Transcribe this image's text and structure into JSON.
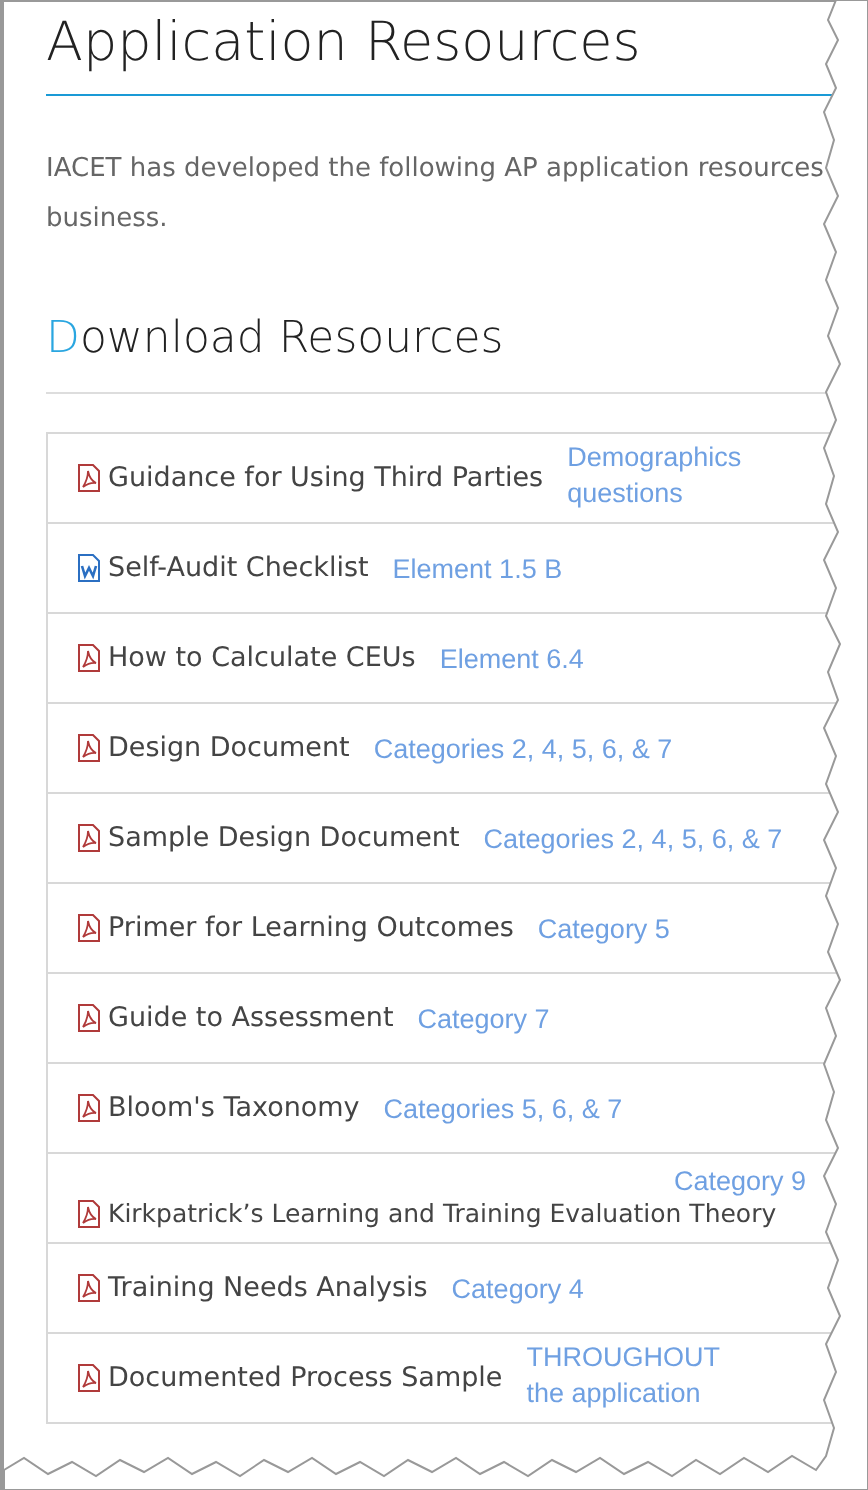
{
  "title": "Application Resources",
  "intro_lines": [
    "IACET has developed the following AP application resources",
    "business."
  ],
  "section_heading": "Download Resources",
  "resources": [
    {
      "kind": "pdf",
      "title": "Guidance for Using Third Parties",
      "note": {
        "kind": "beside",
        "lines": [
          "Demographics",
          "questions"
        ]
      }
    },
    {
      "kind": "word",
      "title": "Self-Audit Checklist",
      "note": {
        "kind": "beside",
        "lines": [
          "Element 1.5 B"
        ]
      }
    },
    {
      "kind": "pdf",
      "title": "How to Calculate CEUs",
      "note": {
        "kind": "beside",
        "lines": [
          "Element 6.4"
        ]
      }
    },
    {
      "kind": "pdf",
      "title": "Design Document",
      "note": {
        "kind": "beside",
        "lines": [
          "Categories 2, 4, 5, 6, & 7"
        ]
      }
    },
    {
      "kind": "pdf",
      "title": "Sample Design Document",
      "note": {
        "kind": "beside",
        "lines": [
          "Categories 2, 4, 5, 6, & 7"
        ]
      }
    },
    {
      "kind": "pdf",
      "title": "Primer for Learning Outcomes",
      "note": {
        "kind": "beside",
        "lines": [
          "Category 5"
        ]
      }
    },
    {
      "kind": "pdf",
      "title": "Guide to Assessment",
      "note": {
        "kind": "beside",
        "lines": [
          "Category 7"
        ]
      }
    },
    {
      "kind": "pdf",
      "title": "Bloom's Taxonomy",
      "note": {
        "kind": "beside",
        "lines": [
          "Categories 5, 6, & 7"
        ]
      }
    },
    {
      "kind": "pdf",
      "title": "Kirkpatrick’s Learning and Training Evaluation Theory",
      "note": {
        "kind": "above",
        "lines": [
          "Category 9"
        ]
      }
    },
    {
      "kind": "pdf",
      "title": "Training Needs Analysis",
      "note": {
        "kind": "beside",
        "lines": [
          "Category 4"
        ]
      }
    },
    {
      "kind": "pdf",
      "title": "Documented Process Sample",
      "note": {
        "kind": "beside",
        "lines": [
          "THROUGHOUT",
          "the application"
        ]
      }
    }
  ]
}
